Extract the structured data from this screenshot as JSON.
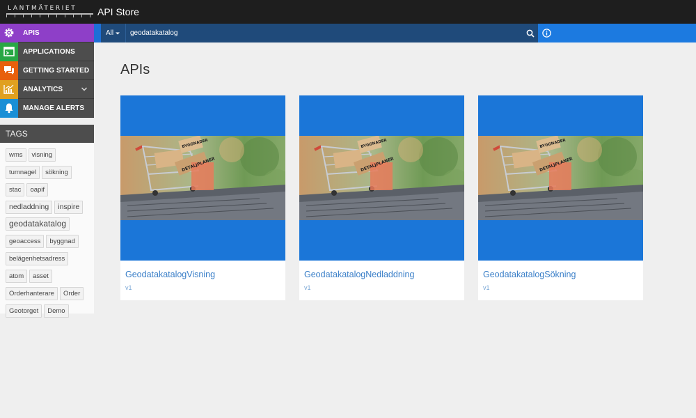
{
  "header": {
    "logo_text": "LANTMÄTERIET",
    "app_title": "API Store"
  },
  "sidebar": {
    "items": [
      {
        "label": "APIS",
        "icon": "gear-icon",
        "color": "#8e3fc8"
      },
      {
        "label": "APPLICATIONS",
        "icon": "application-window-icon",
        "color": "#28a745"
      },
      {
        "label": "GETTING STARTED",
        "icon": "chat-bubbles-icon",
        "color": "#e8600c"
      },
      {
        "label": "ANALYTICS",
        "icon": "bar-chart-icon",
        "color": "#e0a020"
      },
      {
        "label": "MANAGE ALERTS",
        "icon": "bell-icon",
        "color": "#1a8fd6"
      }
    ],
    "tags_header": "TAGS",
    "tags": [
      "wms",
      "visning",
      "tumnagel",
      "sökning",
      "stac",
      "oapif",
      "nedladdning",
      "inspire",
      "geodatakatalog",
      "geoaccess",
      "byggnad",
      "belägenhetsadress",
      "atom",
      "asset",
      "Orderhanterare",
      "Order",
      "Geotorget",
      "Demo"
    ]
  },
  "search": {
    "filter_label": "All",
    "value": "geodatakatalog"
  },
  "main": {
    "title": "APIs",
    "cards": [
      {
        "name": "GeodatakatalogVisning",
        "version": "v1"
      },
      {
        "name": "GeodatakatalogNedladdning",
        "version": "v1"
      },
      {
        "name": "GeodatakatalogSökning",
        "version": "v1"
      }
    ]
  },
  "thumbnail_box_labels": [
    "BYGGNADER",
    "DETALJPLANER"
  ],
  "colors": {
    "topbar": "#1e1e1e",
    "active_nav": "#8e3fc8",
    "searchbar": "#1f4a7a",
    "card_blue": "#1b76d8",
    "link": "#3a7fc8"
  }
}
